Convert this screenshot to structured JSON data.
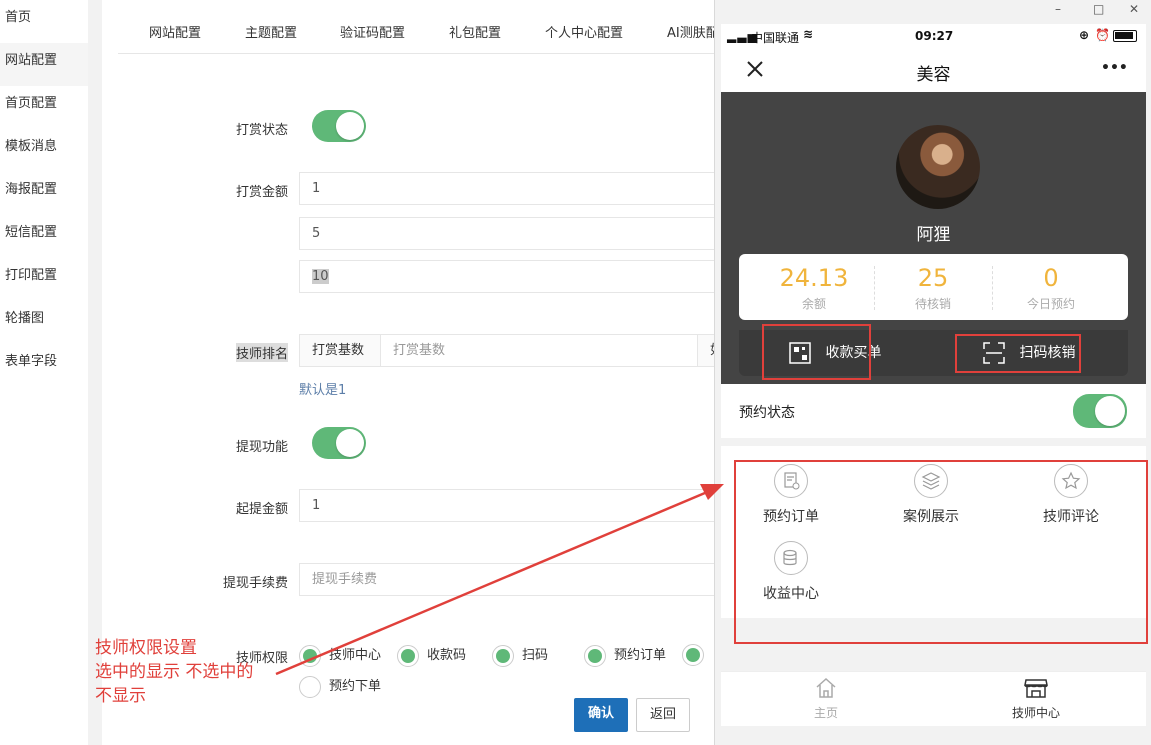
{
  "sidebar": {
    "items": [
      {
        "label": "首页"
      },
      {
        "label": "网站配置"
      },
      {
        "label": "首页配置"
      },
      {
        "label": "模板消息"
      },
      {
        "label": "海报配置"
      },
      {
        "label": "短信配置"
      },
      {
        "label": "打印配置"
      },
      {
        "label": "轮播图"
      },
      {
        "label": "表单字段"
      }
    ]
  },
  "tabs": [
    "网站配置",
    "主题配置",
    "验证码配置",
    "礼包配置",
    "个人中心配置",
    "AI测肤配"
  ],
  "form": {
    "reward_status_label": "打赏状态",
    "reward_amount_label": "打赏金额",
    "reward_amounts": [
      "1",
      "5",
      "10"
    ],
    "tech_rank_label": "技师排名",
    "reward_base_prefix": "打赏基数",
    "reward_base_placeholder": "打赏基数",
    "reward_base_suffix": "如",
    "reward_base_hint": "默认是1",
    "withdraw_label": "提现功能",
    "min_withdraw_label": "起提金额",
    "min_withdraw_value": "1",
    "fee_label": "提现手续费",
    "fee_placeholder": "提现手续费",
    "perm_label": "技师权限",
    "perm_options": [
      {
        "label": "技师中心",
        "checked": true
      },
      {
        "label": "收款码",
        "checked": true
      },
      {
        "label": "扫码",
        "checked": true
      },
      {
        "label": "预约订单",
        "checked": true
      },
      {
        "label": "",
        "checked": true
      },
      {
        "label": "预约下单",
        "checked": false
      }
    ],
    "confirm_label": "确认",
    "back_label": "返回"
  },
  "annotation": {
    "line1": "技师权限设置",
    "line2": "选中的显示  不选中的",
    "line3": "不显示"
  },
  "phone": {
    "window_controls": [
      "–",
      "□",
      "✕"
    ],
    "carrier": "中国联通",
    "time": "09:27",
    "nav_title": "美容",
    "nav_more": "•••",
    "user_name": "阿狸",
    "stats": [
      {
        "value": "24.13",
        "label": "余额"
      },
      {
        "value": "25",
        "label": "待核销"
      },
      {
        "value": "0",
        "label": "今日预约"
      }
    ],
    "action_collect": "收款买单",
    "action_scan": "扫码核销",
    "booking_status_label": "预约状态",
    "grid": [
      {
        "label": "预约订单",
        "icon": "order-icon"
      },
      {
        "label": "案例展示",
        "icon": "layers-icon"
      },
      {
        "label": "技师评论",
        "icon": "star-icon"
      },
      {
        "label": "收益中心",
        "icon": "coins-icon"
      }
    ],
    "tabbar": [
      {
        "label": "主页",
        "icon": "home-icon",
        "active": false
      },
      {
        "label": "技师中心",
        "icon": "store-icon",
        "active": true
      }
    ]
  },
  "colors": {
    "accent_green": "#5fb878",
    "button_blue": "#1e6fb8",
    "annotation_red": "#e0403b",
    "stat_orange": "#f0b43c"
  }
}
